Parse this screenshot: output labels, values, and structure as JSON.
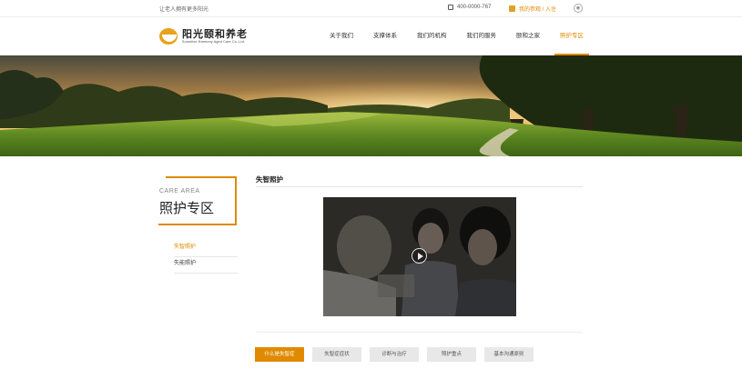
{
  "topbar": {
    "slogan": "让老人拥有更多阳光",
    "phone": "400-0000-767",
    "visit": "我的参观 / 入住"
  },
  "logo": {
    "name": "阳光颐和养老",
    "english": "Sunshine Harmony Aged Care Co.,Ltd."
  },
  "nav": {
    "items": [
      {
        "label": "关于我们"
      },
      {
        "label": "支撑体系"
      },
      {
        "label": "我们的机构"
      },
      {
        "label": "我们的服务"
      },
      {
        "label": "颐和之家"
      },
      {
        "label": "照护专区"
      }
    ],
    "active_index": 5
  },
  "sidebar": {
    "title_en": "CARE AREA",
    "title_cn": "照护专区",
    "items": [
      {
        "label": "失智照护"
      },
      {
        "label": "失能照护"
      }
    ]
  },
  "content": {
    "title": "失智照护"
  },
  "tabs": [
    {
      "label": "什么是失智症"
    },
    {
      "label": "失智症症状"
    },
    {
      "label": "诊断与治疗"
    },
    {
      "label": "照护重点"
    },
    {
      "label": "基本沟通原则"
    }
  ],
  "colors": {
    "accent": "#e08a00",
    "tab_inactive": "#e8e8e8"
  },
  "icons": {
    "phone": "phone-icon",
    "visit": "calendar-icon",
    "wechat": "wechat-icon",
    "play": "play-icon"
  }
}
